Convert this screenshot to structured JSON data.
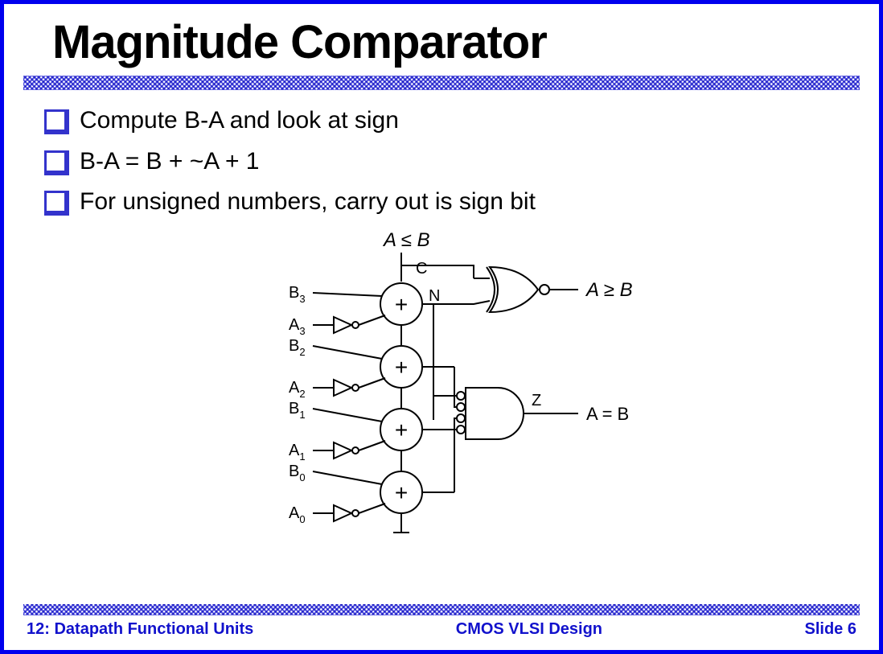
{
  "title": "Magnitude Comparator",
  "bullets": [
    "Compute B-A and look at sign",
    "B-A = B + ~A + 1",
    "For unsigned numbers, carry out is sign bit"
  ],
  "diagram": {
    "top_label": "A ≤ B",
    "c_label": "C",
    "n_label": "N",
    "z_label": "Z",
    "out_geq": "A ≥ B",
    "out_eq": "A = B",
    "inputs": {
      "b3": "B",
      "b3s": "3",
      "a3": "A",
      "a3s": "3",
      "b2": "B",
      "b2s": "2",
      "a2": "A",
      "a2s": "2",
      "b1": "B",
      "b1s": "1",
      "a1": "A",
      "a1s": "1",
      "b0": "B",
      "b0s": "0",
      "a0": "A",
      "a0s": "0"
    },
    "adder": "+"
  },
  "footer": {
    "left": "12: Datapath Functional Units",
    "center": "CMOS VLSI Design",
    "right": "Slide 6"
  }
}
